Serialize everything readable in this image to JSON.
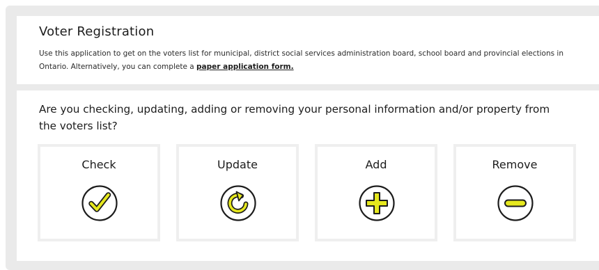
{
  "header": {
    "title": "Voter Registration",
    "description": "Use this application to get on the voters list for municipal, district social services administration board, school board and provincial elections in Ontario. Alternatively, you can complete a",
    "link_label": "paper application form."
  },
  "question": {
    "text": "Are you checking, updating, adding or removing your personal information and/or property from the voters list?"
  },
  "options": [
    {
      "label": "Check",
      "icon": "checkmark-icon"
    },
    {
      "label": "Update",
      "icon": "refresh-icon"
    },
    {
      "label": "Add",
      "icon": "plus-icon"
    },
    {
      "label": "Remove",
      "icon": "minus-icon"
    }
  ],
  "colors": {
    "page_background": "#eaeaea",
    "card_background": "#ffffff",
    "option_border": "#efefef",
    "icon_accent": "#e6e81e",
    "icon_stroke": "#1c1c1c",
    "text": "#1c1c1c"
  }
}
